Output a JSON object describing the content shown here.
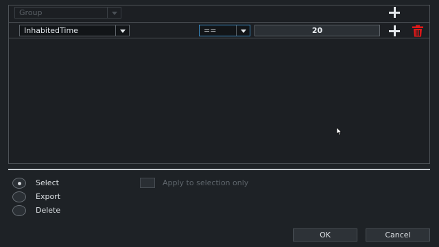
{
  "filter": {
    "group_row": {
      "field": "Group"
    },
    "condition_row": {
      "field": "InhabitedTime",
      "operator": "==",
      "value": "20"
    }
  },
  "actions": {
    "options": [
      {
        "label": "Select",
        "checked": true
      },
      {
        "label": "Export",
        "checked": false
      },
      {
        "label": "Delete",
        "checked": false
      }
    ],
    "apply_to_selection_label": "Apply to selection only"
  },
  "buttons": {
    "ok_label": "OK",
    "cancel_label": "Cancel"
  },
  "icons": {
    "add": "plus-icon",
    "delete": "trash-icon",
    "dropdown": "chevron-down-icon",
    "cursor": "mouse-cursor-icon"
  },
  "colors": {
    "background": "#1e2226",
    "delete_icon": "#e01818",
    "focus_border": "#3c8fc8"
  }
}
